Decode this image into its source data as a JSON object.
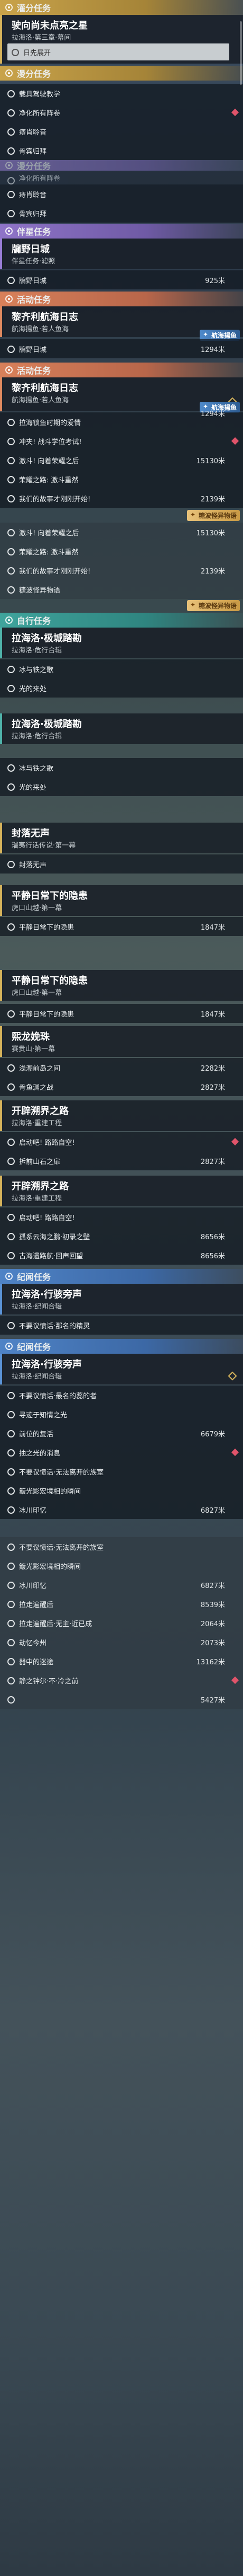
{
  "sections": {
    "lingfen": "灌分任务",
    "lvdu": "漫分任务",
    "banlv": "伴星任务",
    "huodong": "活动任务",
    "ziyou": "自行任务",
    "jiyuan": "纪闻任务"
  },
  "card1": {
    "title": "驶向尚未点亮之星",
    "sub": "拉海洛·第三章·幕间",
    "track": "日先展开"
  },
  "lvdu_items": [
    "载具驾驶教学",
    "净化所有阵卷",
    "痔肖聆音",
    "骨宾归拜"
  ],
  "lvdu_items2": [
    "净化所有阵卷",
    "痔肖聆音",
    "骨宾归拜"
  ],
  "banlv_card": {
    "title": "牖野日城",
    "sub": "伴星任务·滤照",
    "item": "牖野日城",
    "dist": "925米"
  },
  "huodong_card1": {
    "title": "黎齐利航海日志",
    "sub": "航海揚鱼·若人鱼海",
    "item": "牖野日城",
    "dist": "1294米",
    "tag": "航海揚鱼"
  },
  "huodong_card2": {
    "title": "黎齐利航海日志",
    "sub": "航海揚鱼·若人鱼海",
    "tag": "航海揚鱼",
    "dist_tag": "1294米",
    "items": [
      [
        "拉海锁鱼时期的爱情",
        ""
      ],
      [
        "冲夹! 战斗学位考试!",
        ""
      ],
      [
        "激斗! 向着荣耀之后",
        "15130米"
      ],
      [
        "荣耀之路: 激斗重然",
        ""
      ],
      [
        "我们的故事才刚刚开始!",
        "2139米"
      ]
    ]
  },
  "huodong_items2": [
    [
      "激斗! 向着荣耀之后",
      "15130米"
    ],
    [
      "荣耀之路: 激斗重然",
      ""
    ],
    [
      "我们的故事才刚刚开始!",
      "2139米"
    ],
    [
      "糖波怪异物语",
      ""
    ]
  ],
  "tag_gold": "糖波怪异物语",
  "ziyou_card1": {
    "title": "拉海洛·极城踏勘",
    "sub": "拉海洛·危行合辑",
    "items": [
      "冰与铁之歌",
      "光的来处"
    ]
  },
  "ziyou_card2": {
    "title": "拉海洛·极城踏勘",
    "sub": "拉海洛·危行合辑",
    "items": [
      "冰与铁之歌",
      "光的来处"
    ]
  },
  "card_fengqi": {
    "title": "封落无声",
    "sub": "瑞夷行话传说·第一幕",
    "item": "封落无声"
  },
  "card_pingjing1": {
    "title": "平静日常下的隐患",
    "sub": "虎口山越·第一幕",
    "item": "平静日常下的隐患",
    "dist": "1847米"
  },
  "card_pingjing2": {
    "title": "平静日常下的隐患",
    "sub": "虎口山越·第一幕",
    "item": "平静日常下的隐患",
    "dist": "1847米"
  },
  "card_xilong": {
    "title": "熙龙娩珠",
    "sub": "赛贵山·第一幕",
    "items": [
      [
        "浅潮前岛之间",
        "2282米"
      ],
      [
        "骨鱼渊之战",
        "2827米"
      ]
    ]
  },
  "card_kaibi1": {
    "title": "开辟溯界之路",
    "sub": "拉海洛·重建工程",
    "items": [
      [
        "启动吧! 路路自空!",
        ""
      ],
      [
        "拆前山石之扉",
        "2827米"
      ]
    ]
  },
  "card_kaibi2": {
    "title": "开辟溯界之路",
    "sub": "拉海洛·重建工程",
    "items": [
      [
        "启动吧! 路路自空!",
        ""
      ],
      [
        "孤系云海之鹏·初录之壁",
        "8656米"
      ],
      [
        "古海遗路航·回声回望",
        "8656米"
      ]
    ]
  },
  "jiyuan_card1": {
    "title": "拉海洛·行骇旁声",
    "sub": "拉海洛·纪闻合辑",
    "item": "不要议愤话·那名的精灵"
  },
  "jiyuan_card2": {
    "title": "拉海洛·行骇旁声",
    "sub": "拉海洛·纪闻合辑",
    "items": [
      [
        "不要议愤话·最名的蕊的者",
        ""
      ],
      [
        "寻迹于知情之光",
        ""
      ],
      [
        "前位的复活",
        "6679米"
      ],
      [
        "抽之光的消息",
        ""
      ],
      [
        "不要议愤话·无法离开的族室",
        ""
      ],
      [
        "簸光影宏境相的瞬间",
        ""
      ],
      [
        "冰川印忆",
        "6827米"
      ]
    ]
  },
  "jiyuan_items2": [
    [
      "不要议愤话·无法离开的族室",
      ""
    ],
    [
      "簸光影宏境相的瞬间",
      ""
    ],
    [
      "冰川印忆",
      "6827米"
    ],
    [
      "拉走遍醒后",
      "8539米"
    ],
    [
      "拉走遍醒后·无主·近已成",
      "2064米"
    ],
    [
      "劫忆今州",
      "2073米"
    ],
    [
      "器中的迷途",
      "13162米"
    ],
    [
      "静之钟尔·不·冷之前",
      ""
    ],
    [
      "",
      "5427米"
    ]
  ]
}
